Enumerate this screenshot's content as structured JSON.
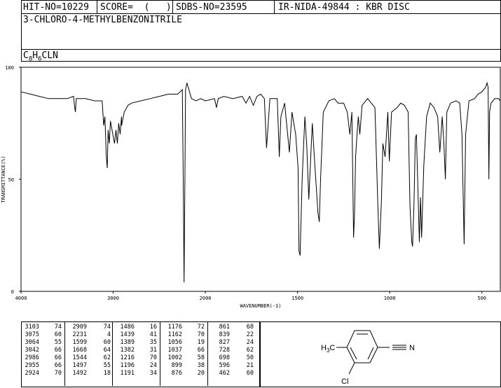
{
  "header": {
    "hit_no": "HIT-NO=10229",
    "score": "SCORE=  (   )",
    "sdbs_no": "SDBS-NO=23595",
    "ir_info": "IR-NIDA-49844 : KBR DISC",
    "compound_name": "3-CHLORO-4-METHYLBENZONITRILE",
    "formula": {
      "c": "C",
      "c_n": "8",
      "h": "H",
      "h_n": "6",
      "rest": "CLN"
    }
  },
  "chart_data": {
    "type": "line",
    "title": "",
    "xlabel": "WAVENUMBER(-1)",
    "ylabel": "TRANSMITTANCE(%)",
    "xlim": [
      4000,
      400
    ],
    "ylim": [
      0,
      100
    ],
    "x_ticks": [
      "4000",
      "3000",
      "2000",
      "1500",
      "1000",
      "500"
    ],
    "y_ticks": [
      "100",
      "50",
      "0"
    ],
    "series": [
      {
        "x": [
          4000,
          3900,
          3800,
          3700,
          3600,
          3500,
          3430,
          3420,
          3410,
          3400,
          3300,
          3200,
          3120,
          3103,
          3090,
          3075,
          3064,
          3055,
          3042,
          3030,
          2986,
          2970,
          2955,
          2940,
          2924,
          2910,
          2909,
          2880,
          2840,
          2800,
          2700,
          2600,
          2500,
          2400,
          2300,
          2250,
          2240,
          2231,
          2222,
          2215,
          2200,
          2150,
          2100,
          2050,
          2000,
          1950,
          1940,
          1930,
          1900,
          1850,
          1800,
          1780,
          1760,
          1740,
          1720,
          1700,
          1680,
          1668,
          1650,
          1610,
          1599,
          1590,
          1570,
          1544,
          1530,
          1510,
          1497,
          1492,
          1486,
          1475,
          1460,
          1450,
          1439,
          1420,
          1405,
          1389,
          1382,
          1375,
          1360,
          1330,
          1300,
          1280,
          1250,
          1230,
          1216,
          1205,
          1196,
          1191,
          1185,
          1176,
          1170,
          1162,
          1150,
          1120,
          1100,
          1080,
          1065,
          1056,
          1045,
          1037,
          1025,
          1010,
          1002,
          990,
          960,
          940,
          920,
          900,
          890,
          880,
          876,
          868,
          861,
          855,
          845,
          839,
          833,
          827,
          815,
          800,
          780,
          760,
          740,
          728,
          715,
          706,
          698,
          690,
          670,
          640,
          620,
          608,
          596,
          588,
          570,
          540,
          520,
          500,
          490,
          480,
          472,
          466,
          462,
          458,
          450,
          440,
          430,
          420,
          410,
          400
        ],
        "y": [
          89,
          88,
          87,
          86,
          86,
          86,
          87,
          83,
          80,
          86,
          86,
          85,
          85,
          74,
          78,
          60,
          55,
          72,
          66,
          76,
          66,
          72,
          66,
          75,
          70,
          78,
          74,
          80,
          83,
          84,
          85,
          86,
          87,
          88,
          88,
          90,
          50,
          4,
          50,
          90,
          93,
          86,
          85,
          86,
          85,
          86,
          82,
          86,
          87,
          86,
          87,
          84,
          87,
          83,
          87,
          88,
          86,
          64,
          86,
          86,
          60,
          78,
          84,
          62,
          80,
          70,
          55,
          18,
          16,
          50,
          78,
          65,
          41,
          75,
          55,
          35,
          31,
          50,
          80,
          85,
          86,
          84,
          84,
          80,
          70,
          80,
          24,
          34,
          60,
          72,
          78,
          70,
          83,
          86,
          84,
          82,
          40,
          19,
          40,
          66,
          60,
          80,
          58,
          80,
          82,
          84,
          83,
          80,
          38,
          22,
          20,
          40,
          68,
          70,
          40,
          22,
          42,
          24,
          56,
          78,
          84,
          82,
          78,
          62,
          78,
          66,
          50,
          80,
          84,
          85,
          84,
          70,
          21,
          70,
          85,
          86,
          88,
          89,
          90,
          91,
          93,
          91,
          50,
          80,
          84,
          85,
          86,
          86,
          86,
          85
        ]
      }
    ],
    "peak_table": [
      [
        "3103",
        "74",
        "2909",
        "74",
        "1486",
        "16",
        "1176",
        "72",
        "861",
        "68"
      ],
      [
        "3075",
        "60",
        "2231",
        "4",
        "1439",
        "41",
        "1162",
        "70",
        "839",
        "22"
      ],
      [
        "3064",
        "55",
        "1599",
        "60",
        "1389",
        "35",
        "1056",
        "19",
        "827",
        "24"
      ],
      [
        "3042",
        "66",
        "1668",
        "64",
        "1382",
        "31",
        "1037",
        "66",
        "728",
        "62"
      ],
      [
        "2986",
        "66",
        "1544",
        "62",
        "1216",
        "70",
        "1002",
        "58",
        "698",
        "50"
      ],
      [
        "2955",
        "66",
        "1497",
        "55",
        "1196",
        "24",
        "899",
        "38",
        "596",
        "21"
      ],
      [
        "2924",
        "70",
        "1492",
        "18",
        "1191",
        "34",
        "876",
        "20",
        "462",
        "60"
      ]
    ]
  },
  "structure": {
    "h3c_label_h": "H",
    "h3c_label_sub": "3",
    "h3c_label_c": "C",
    "nitrile_n": "N",
    "chloro_label": "Cl"
  }
}
